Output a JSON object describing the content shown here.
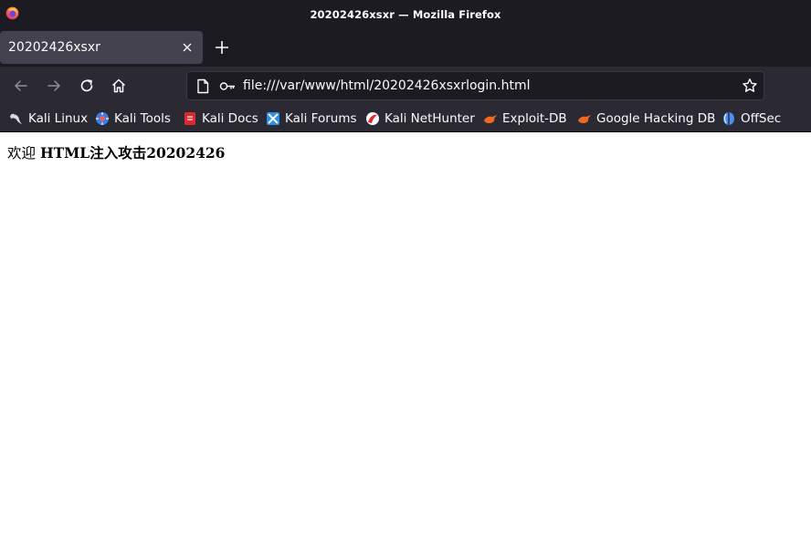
{
  "window": {
    "title": "20202426xsxr — Mozilla Firefox",
    "logo_icon": "firefox-logo-icon"
  },
  "tabs": [
    {
      "label": "20202426xsxr",
      "active": true
    }
  ],
  "nav": {
    "back_icon": "arrow-left-icon",
    "forward_icon": "arrow-right-icon",
    "reload_icon": "reload-icon",
    "home_icon": "home-icon",
    "url": "file:///var/www/html/20202426xsxrlogin.html",
    "bookmark_star_icon": "star-icon"
  },
  "bookmarks": [
    {
      "label": "Kali Linux",
      "icon": "kali-dragon-icon"
    },
    {
      "label": "Kali Tools",
      "icon": "kali-tools-icon"
    },
    {
      "label": "Kali Docs",
      "icon": "kali-docs-icon"
    },
    {
      "label": "Kali Forums",
      "icon": "kali-forums-icon"
    },
    {
      "label": "Kali NetHunter",
      "icon": "nethunter-icon"
    },
    {
      "label": "Exploit-DB",
      "icon": "exploit-db-icon"
    },
    {
      "label": "Google Hacking DB",
      "icon": "ghdb-icon"
    },
    {
      "label": "OffSec",
      "icon": "offsec-icon"
    }
  ],
  "page": {
    "welcome_prefix": "欢迎",
    "welcome_bold": "HTML注入攻击20202426"
  },
  "colors": {
    "chrome_dark": "#1c1b22",
    "toolbar": "#2b2a33",
    "tab_active": "#42414d",
    "text_light": "#fbfbfe"
  }
}
